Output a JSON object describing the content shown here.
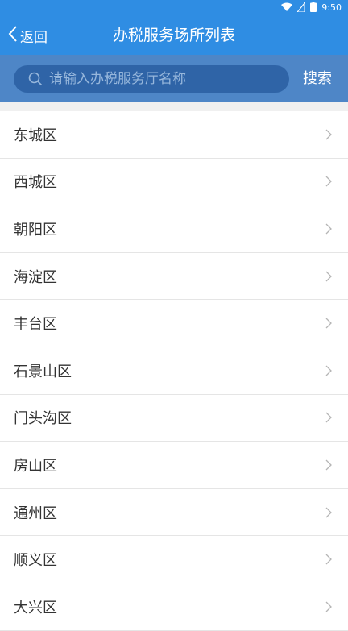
{
  "status_bar": {
    "time": "9:50",
    "icons": [
      "wifi-icon",
      "signal-icon",
      "battery-icon"
    ]
  },
  "header": {
    "back_label": "返回",
    "title": "办税服务场所列表"
  },
  "search": {
    "placeholder": "请输入办税服务厅名称",
    "button_label": "搜索"
  },
  "districts": [
    {
      "label": "东城区"
    },
    {
      "label": "西城区"
    },
    {
      "label": "朝阳区"
    },
    {
      "label": "海淀区"
    },
    {
      "label": "丰台区"
    },
    {
      "label": "石景山区"
    },
    {
      "label": "门头沟区"
    },
    {
      "label": "房山区"
    },
    {
      "label": "通州区"
    },
    {
      "label": "顺义区"
    },
    {
      "label": "大兴区"
    }
  ],
  "colors": {
    "header_blue": "#2f8de3",
    "search_bar_blue": "#4e86c7",
    "search_field_blue": "#2f64a7"
  }
}
